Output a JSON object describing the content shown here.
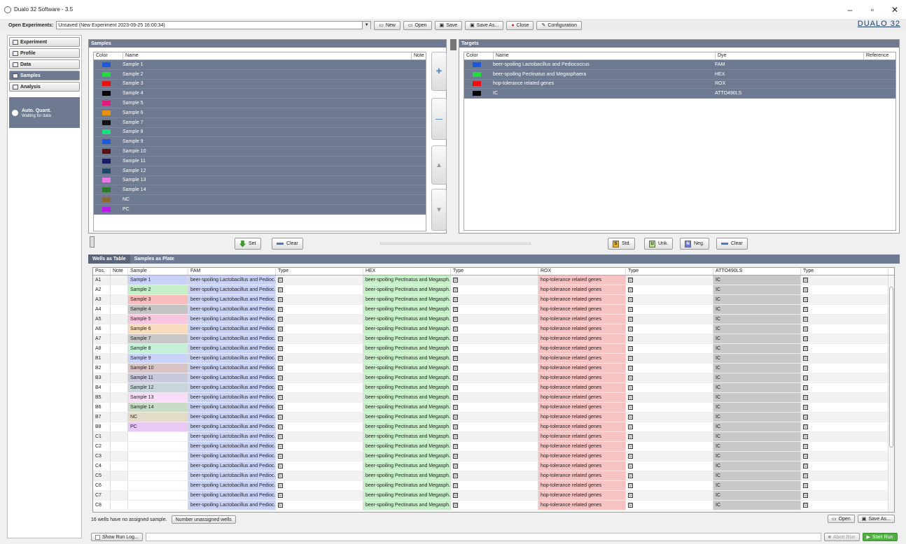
{
  "window": {
    "title": "Dualo 32 Software - 3.5"
  },
  "toolbar": {
    "open_label": "Open Experiments:",
    "experiment": "Unsaved (New Experiment 2023-09-25 16:00:34)",
    "buttons": [
      "New",
      "Open",
      "Save",
      "Save As...",
      "Close",
      "Configuration"
    ],
    "logo": "DUALO 32"
  },
  "nav": {
    "items": [
      "Experiment",
      "Profile",
      "Data",
      "Samples",
      "Analysis"
    ],
    "selected": "Samples",
    "auto_title": "Auto. Quant.",
    "auto_status": "Waiting for data"
  },
  "samples": {
    "header": "Samples",
    "columns": [
      "Color",
      "Name",
      "Note"
    ],
    "rows": [
      {
        "name": "Sample 1",
        "color": "#1a5adf"
      },
      {
        "name": "Sample 2",
        "color": "#1fe03a"
      },
      {
        "name": "Sample 3",
        "color": "#e81010"
      },
      {
        "name": "Sample 4",
        "color": "#000000"
      },
      {
        "name": "Sample 5",
        "color": "#e01a7a"
      },
      {
        "name": "Sample 6",
        "color": "#e89010"
      },
      {
        "name": "Sample 7",
        "color": "#111111"
      },
      {
        "name": "Sample 8",
        "color": "#18e07a"
      },
      {
        "name": "Sample 9",
        "color": "#1a5adf"
      },
      {
        "name": "Sample 10",
        "color": "#5a1010"
      },
      {
        "name": "Sample 11",
        "color": "#1a1a6a"
      },
      {
        "name": "Sample 12",
        "color": "#1a4a6a"
      },
      {
        "name": "Sample 13",
        "color": "#e87ae8"
      },
      {
        "name": "Sample 14",
        "color": "#2a7a2a"
      },
      {
        "name": "NC",
        "color": "#8a6a3a"
      },
      {
        "name": "PC",
        "color": "#b81ae8"
      }
    ]
  },
  "targets": {
    "header": "Targets",
    "columns": [
      "Color",
      "Name",
      "Dye",
      "Reference"
    ],
    "rows": [
      {
        "name": "beer-spoiling Lactobacillus and Pediococcus",
        "dye": "FAM",
        "color": "#1a5adf"
      },
      {
        "name": "beer-spoiling Pectinatus and Megasphaera",
        "dye": "HEX",
        "color": "#1fe03a"
      },
      {
        "name": "hop-tolerance related genes",
        "dye": "ROX",
        "color": "#e81010"
      },
      {
        "name": "IC",
        "dye": "ATTO490LS",
        "color": "#000000"
      }
    ]
  },
  "actions": {
    "set": "Set",
    "clear": "Clear",
    "std": "Std.",
    "unk": "Unk.",
    "neg": "Neg."
  },
  "tabs": [
    "Wells as Table",
    "Samples as Plate"
  ],
  "grid": {
    "columns": [
      "Pos.",
      "Note",
      "Sample",
      "FAM",
      "Type",
      "HEX",
      "Type",
      "ROX",
      "Type",
      "ATTO490LS",
      "Type"
    ],
    "fam_text": "beer-spoiling Lactobacillus and Pedioc...",
    "hex_text": "beer-spoiling Pectinatus and Megasph...",
    "rox_text": "hop-tolerance related genes",
    "atto_text": "IC",
    "type_text": "U",
    "rows": [
      {
        "pos": "A1",
        "sample": "Sample 1",
        "color": "#c9d2f8"
      },
      {
        "pos": "A2",
        "sample": "Sample 2",
        "color": "#c5f0c8"
      },
      {
        "pos": "A3",
        "sample": "Sample 3",
        "color": "#f7bdbd"
      },
      {
        "pos": "A4",
        "sample": "Sample 4",
        "color": "#c4c4c4"
      },
      {
        "pos": "A5",
        "sample": "Sample 5",
        "color": "#f8c5df"
      },
      {
        "pos": "A6",
        "sample": "Sample 6",
        "color": "#f7dcbd"
      },
      {
        "pos": "A7",
        "sample": "Sample 7",
        "color": "#c8c8c8"
      },
      {
        "pos": "A8",
        "sample": "Sample 8",
        "color": "#c4f0d8"
      },
      {
        "pos": "B1",
        "sample": "Sample 9",
        "color": "#c9d2f8"
      },
      {
        "pos": "B2",
        "sample": "Sample 10",
        "color": "#d8c4c4"
      },
      {
        "pos": "B3",
        "sample": "Sample 11",
        "color": "#c9c9dc"
      },
      {
        "pos": "B4",
        "sample": "Sample 12",
        "color": "#c8d6dc"
      },
      {
        "pos": "B5",
        "sample": "Sample 13",
        "color": "#f8ddf8"
      },
      {
        "pos": "B6",
        "sample": "Sample 14",
        "color": "#c8dcc8"
      },
      {
        "pos": "B7",
        "sample": "NC",
        "color": "#e4dac8"
      },
      {
        "pos": "B8",
        "sample": "PC",
        "color": "#e9c8f5"
      },
      {
        "pos": "C1",
        "sample": "",
        "color": "#ffffff"
      },
      {
        "pos": "C2",
        "sample": "",
        "color": "#ffffff"
      },
      {
        "pos": "C3",
        "sample": "",
        "color": "#ffffff"
      },
      {
        "pos": "C4",
        "sample": "",
        "color": "#ffffff"
      },
      {
        "pos": "C5",
        "sample": "",
        "color": "#ffffff"
      },
      {
        "pos": "C6",
        "sample": "",
        "color": "#ffffff"
      },
      {
        "pos": "C7",
        "sample": "",
        "color": "#ffffff"
      },
      {
        "pos": "C8",
        "sample": "",
        "color": "#ffffff"
      }
    ]
  },
  "footer": {
    "unassigned_text": "16 wells have no assigned sample.",
    "number_btn": "Number unassigned wells",
    "open": "Open",
    "save_as": "Save As...",
    "show_log": "Show Run Log...",
    "abort": "Abort Run",
    "start": "Start Run"
  }
}
